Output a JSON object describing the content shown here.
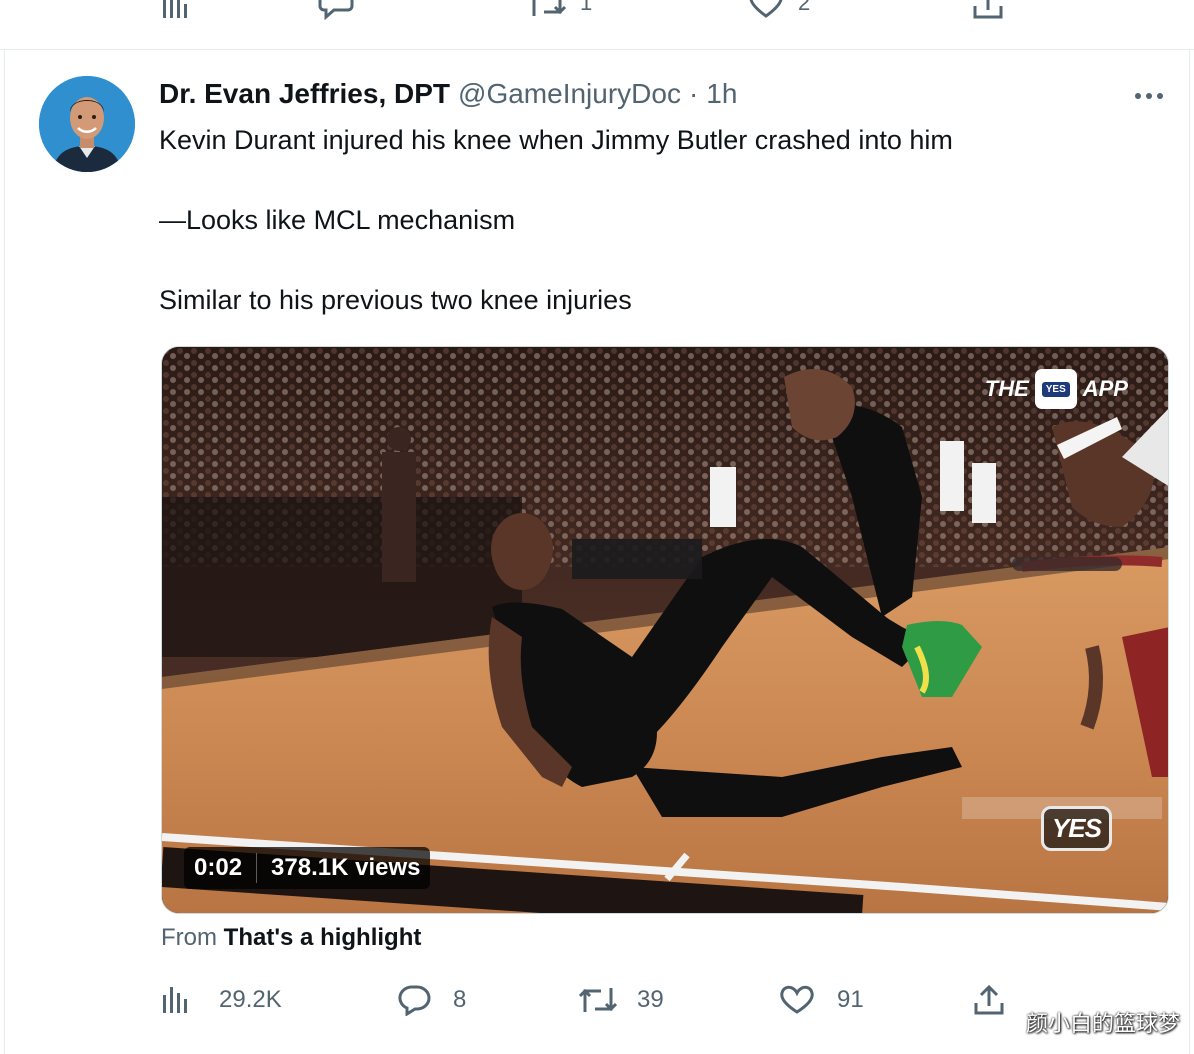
{
  "prev_tweet": {
    "retweets": "1",
    "likes": "2"
  },
  "tweet": {
    "display_name": "Dr. Evan Jeffries, DPT",
    "handle": "@GameInjuryDoc",
    "separator": "·",
    "time": "1h",
    "lines": [
      "Kevin Durant injured his knee when Jimmy Butler crashed into him",
      "—Looks like MCL mechanism",
      "Similar to his previous two knee injuries"
    ],
    "video": {
      "timestamp": "0:02",
      "views": "378.1K views",
      "broadcaster_logo": "YES",
      "app_logo_left": "THE",
      "app_logo_mid": "YES",
      "app_logo_right": "APP"
    },
    "source_prefix": "From",
    "source_name": "That's a highlight",
    "actions": {
      "views": "29.2K",
      "replies": "8",
      "retweets": "39",
      "likes": "91"
    }
  },
  "watermark": "颜小白的篮球梦",
  "icons": {
    "views": "bar-chart-icon",
    "reply": "reply-icon",
    "retweet": "retweet-icon",
    "like": "heart-icon",
    "share": "share-icon",
    "more": "more-icon"
  },
  "colors": {
    "muted_text": "#536471",
    "primary_text": "#0f1419",
    "border": "#e6ecf0"
  }
}
